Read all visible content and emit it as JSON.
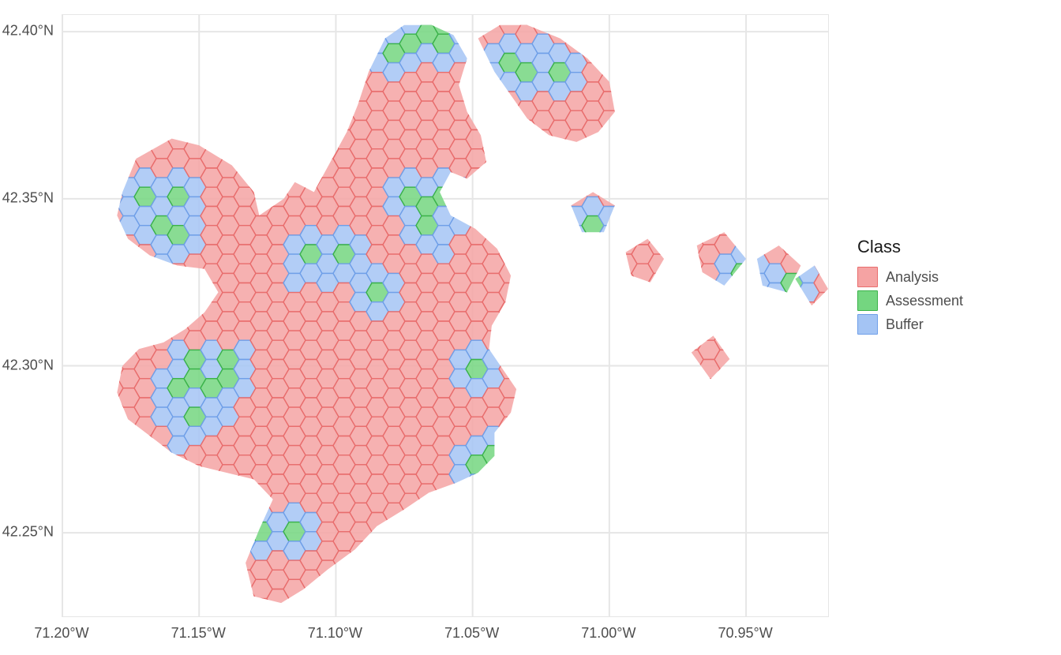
{
  "axes": {
    "x_ticks": [
      "71.20°W",
      "71.15°W",
      "71.10°W",
      "71.05°W",
      "71.00°W",
      "70.95°W"
    ],
    "y_ticks": [
      "42.40°N",
      "42.35°N",
      "42.30°N",
      "42.25°N"
    ]
  },
  "legend": {
    "title": "Class",
    "items": [
      {
        "label": "Analysis",
        "fill": "#f5a3a3",
        "stroke": "#e86d6d"
      },
      {
        "label": "Assessment",
        "fill": "#74d680",
        "stroke": "#3bb24a"
      },
      {
        "label": "Buffer",
        "fill": "#a4c4f4",
        "stroke": "#6f9fe8"
      }
    ]
  },
  "chart_data": {
    "type": "map",
    "title": "",
    "projection": "geographic (lon/lat)",
    "x_range_lon": [
      -71.2,
      -70.92
    ],
    "y_range_lat": [
      42.225,
      42.405
    ],
    "description": "Hexagonal grid over Boston-area polygon, each hex classified as Analysis, Buffer, or Assessment. A few green Assessment hex centers are each surrounded by a ring of blue Buffer hexes; remaining area is pink Analysis hexes, clipped to the city/harbor boundary.",
    "classes": [
      "Analysis",
      "Assessment",
      "Buffer"
    ],
    "class_colors": {
      "Analysis": "#f5a3a3",
      "Assessment": "#74d680",
      "Buffer": "#a4c4f4"
    },
    "assessment_centers_lonlat": [
      [
        -71.17,
        42.349
      ],
      [
        -71.164,
        42.344
      ],
      [
        -71.158,
        42.349
      ],
      [
        -71.159,
        42.338
      ],
      [
        -71.152,
        42.299
      ],
      [
        -71.145,
        42.291
      ],
      [
        -71.14,
        42.299
      ],
      [
        -71.158,
        42.291
      ],
      [
        -71.152,
        42.283
      ],
      [
        -71.138,
        42.25
      ],
      [
        -71.126,
        42.25
      ],
      [
        -71.114,
        42.25
      ],
      [
        -71.109,
        42.331
      ],
      [
        -71.097,
        42.331
      ],
      [
        -71.085,
        42.322
      ],
      [
        -71.076,
        42.395
      ],
      [
        -71.07,
        42.399
      ],
      [
        -71.07,
        42.349
      ],
      [
        -71.065,
        42.34
      ],
      [
        -71.058,
        42.349
      ],
      [
        -71.06,
        42.399
      ],
      [
        -71.047,
        42.299
      ],
      [
        -71.046,
        42.272
      ],
      [
        -71.033,
        42.39
      ],
      [
        -71.02,
        42.39
      ],
      [
        -71.007,
        42.34
      ],
      [
        -70.948,
        42.328
      ],
      [
        -70.935,
        42.322
      ]
    ],
    "buffer_rule": "hexes adjacent to any Assessment center",
    "default_class": "Analysis",
    "hex_spacing_deg_approx": 0.0065
  }
}
